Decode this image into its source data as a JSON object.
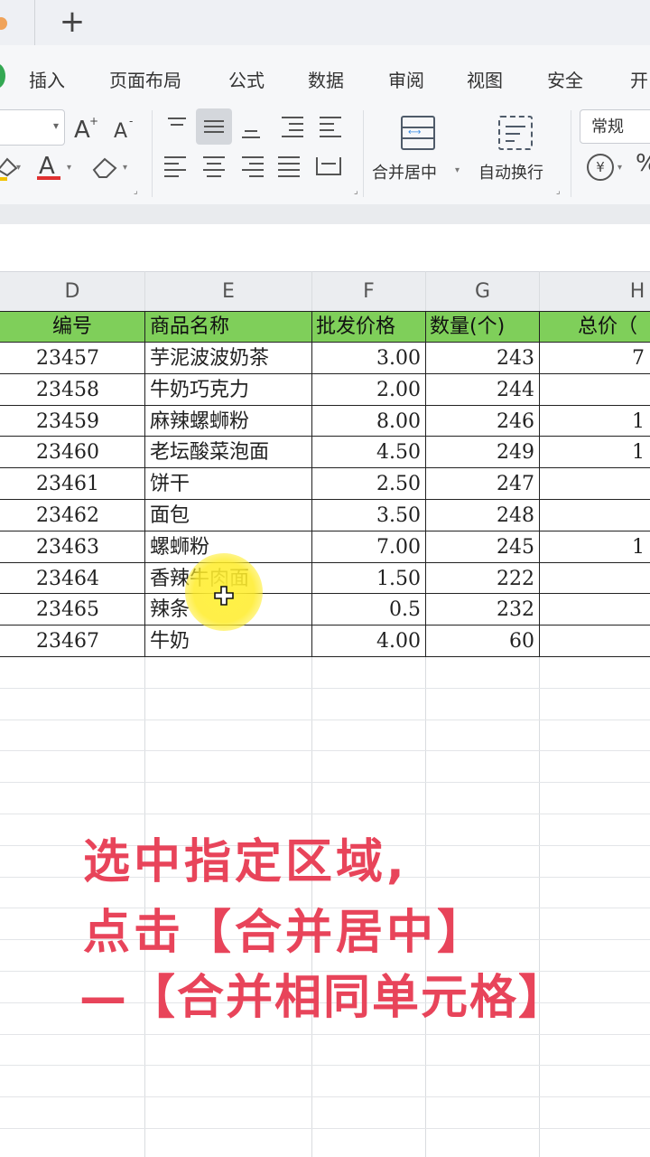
{
  "window": {
    "new_tab_label": "+"
  },
  "menu": [
    "插入",
    "页面布局",
    "公式",
    "数据",
    "审阅",
    "视图",
    "安全",
    "开"
  ],
  "ribbon": {
    "merge_center_label": "合并居中",
    "wrap_text_label": "自动换行",
    "number_format_value": "常规",
    "currency_symbol": "¥",
    "percent_symbol": "%",
    "font_color_letter": "A",
    "font_color_hex": "#e03030",
    "fill_color_hex": "#f2c200"
  },
  "columns": [
    "D",
    "E",
    "F",
    "G",
    "H"
  ],
  "table": {
    "header_fill_hex": "#7fcf5a",
    "headers": [
      "编号",
      "商品名称",
      "批发价格",
      "数量(个)",
      "总价（"
    ],
    "rows": [
      [
        "23457",
        "芋泥波波奶茶",
        "3.00",
        "243",
        "7"
      ],
      [
        "23458",
        "牛奶巧克力",
        "2.00",
        "244",
        ""
      ],
      [
        "23459",
        "麻辣螺蛳粉",
        "8.00",
        "246",
        "1"
      ],
      [
        "23460",
        "老坛酸菜泡面",
        "4.50",
        "249",
        "1"
      ],
      [
        "23461",
        "饼干",
        "2.50",
        "247",
        ""
      ],
      [
        "23462",
        "面包",
        "3.50",
        "248",
        ""
      ],
      [
        "23463",
        "螺蛳粉",
        "7.00",
        "245",
        "1"
      ],
      [
        "23464",
        "香辣牛肉面",
        "1.50",
        "222",
        ""
      ],
      [
        "23465",
        "辣条",
        "0.5",
        "232",
        ""
      ],
      [
        "23467",
        "牛奶",
        "4.00",
        "60",
        ""
      ]
    ]
  },
  "caption": {
    "color_hex": "#e8445a",
    "line1": "选中指定区域,",
    "line2": "点击【合并居中】",
    "line3": "—【合并相同单元格】"
  }
}
